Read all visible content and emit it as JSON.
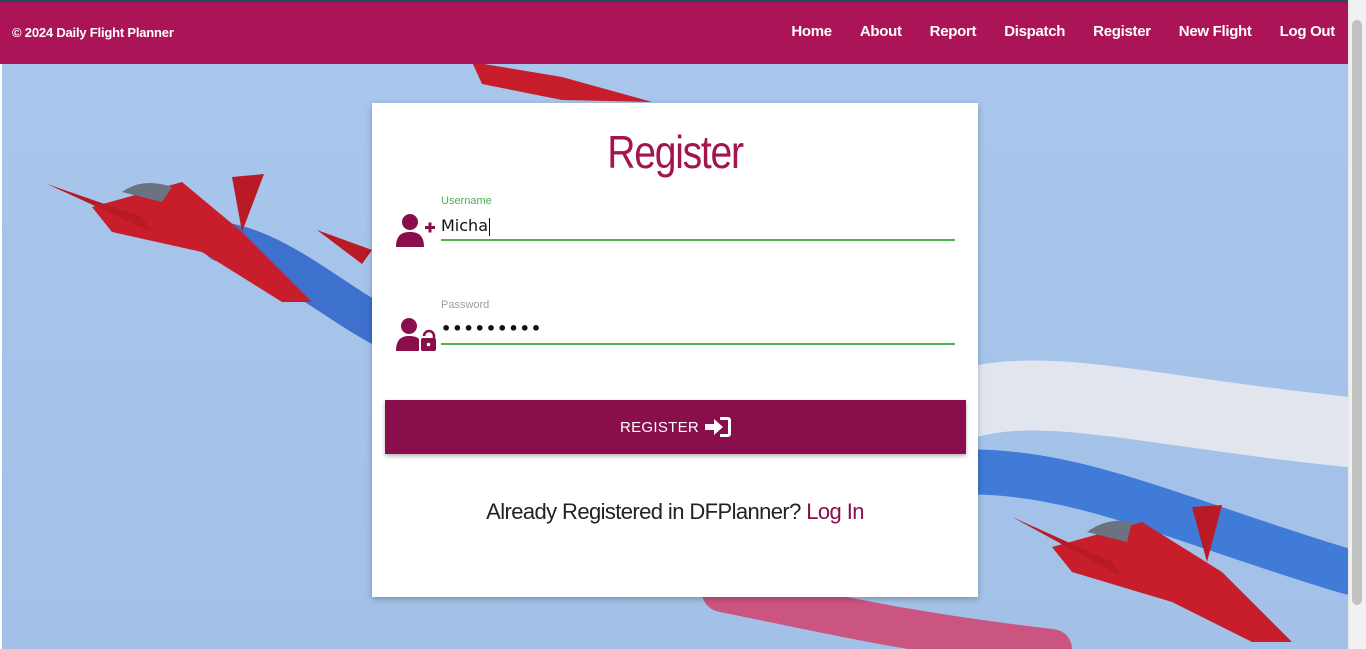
{
  "header": {
    "brand": "© 2024 Daily Flight Planner",
    "nav": [
      {
        "label": "Home"
      },
      {
        "label": "About"
      },
      {
        "label": "Report"
      },
      {
        "label": "Dispatch"
      },
      {
        "label": "Register"
      },
      {
        "label": "New Flight"
      },
      {
        "label": "Log Out"
      }
    ]
  },
  "form": {
    "title": "Register",
    "username": {
      "label": "Username",
      "value": "Micha"
    },
    "password": {
      "label": "Password",
      "masked_value": "•••••••••"
    },
    "submit_label": "REGISTER",
    "footer_text": "Already Registered in DFPlanner?",
    "login_link": "Log In"
  },
  "icons": {
    "username": "user-plus-icon",
    "password": "user-lock-icon",
    "submit": "sign-in-icon"
  },
  "colors": {
    "brand": "#ab1457",
    "button": "#8a0e4b",
    "title": "#a3154f",
    "input_underline": "#4caf50"
  }
}
